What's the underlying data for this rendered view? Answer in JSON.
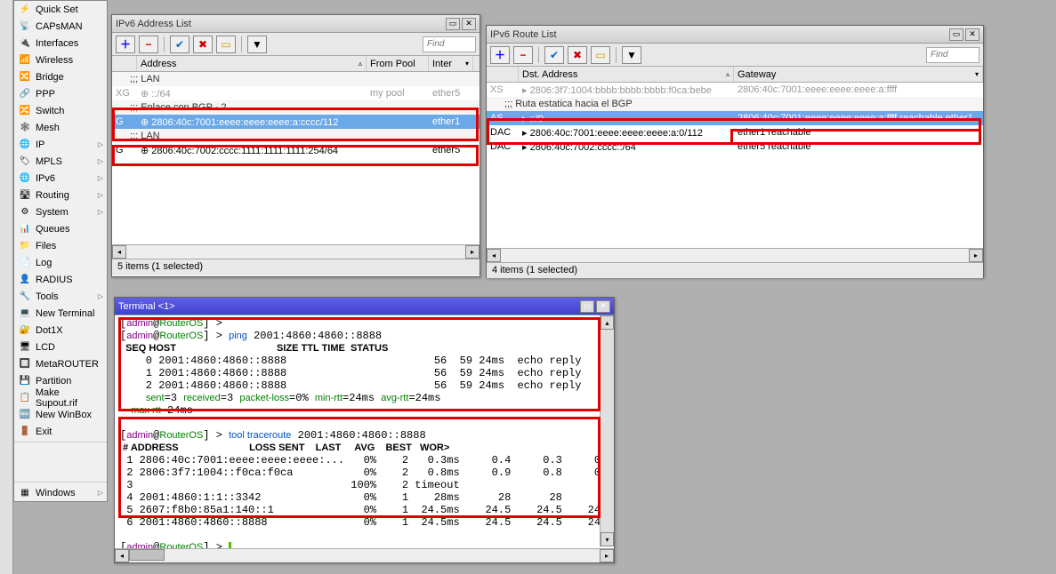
{
  "sidebar": {
    "items": [
      {
        "icon": "⚡",
        "label": "Quick Set"
      },
      {
        "icon": "📡",
        "label": "CAPsMAN"
      },
      {
        "icon": "🔌",
        "label": "Interfaces"
      },
      {
        "icon": "📶",
        "label": "Wireless"
      },
      {
        "icon": "🔀",
        "label": "Bridge"
      },
      {
        "icon": "🔗",
        "label": "PPP"
      },
      {
        "icon": "🔀",
        "label": "Switch"
      },
      {
        "icon": "🕸",
        "label": "Mesh"
      },
      {
        "icon": "🌐",
        "label": "IP",
        "sub": true
      },
      {
        "icon": "🏷",
        "label": "MPLS",
        "sub": true
      },
      {
        "icon": "🌐",
        "label": "IPv6",
        "sub": true
      },
      {
        "icon": "🛣",
        "label": "Routing",
        "sub": true
      },
      {
        "icon": "⚙",
        "label": "System",
        "sub": true
      },
      {
        "icon": "📊",
        "label": "Queues"
      },
      {
        "icon": "📁",
        "label": "Files"
      },
      {
        "icon": "📄",
        "label": "Log"
      },
      {
        "icon": "👤",
        "label": "RADIUS"
      },
      {
        "icon": "🔧",
        "label": "Tools",
        "sub": true
      },
      {
        "icon": "💻",
        "label": "New Terminal"
      },
      {
        "icon": "🔐",
        "label": "Dot1X"
      },
      {
        "icon": "🖥",
        "label": "LCD"
      },
      {
        "icon": "🔲",
        "label": "MetaROUTER"
      },
      {
        "icon": "💾",
        "label": "Partition"
      },
      {
        "icon": "📋",
        "label": "Make Supout.rif"
      },
      {
        "icon": "🆕",
        "label": "New WinBox"
      },
      {
        "icon": "🚪",
        "label": "Exit"
      }
    ],
    "windows_label": "Windows"
  },
  "addr_window": {
    "title": "IPv6 Address List",
    "find": "Find",
    "headers": {
      "address": "Address",
      "from_pool": "From Pool",
      "interface": "Inter"
    },
    "rows": [
      {
        "flag": "",
        "comment": ";;; LAN"
      },
      {
        "flag": "XG",
        "addr": "::/64",
        "pool": "my pool",
        "iface": "ether5",
        "gray": true
      },
      {
        "flag": "",
        "comment": ";;; Enlace con BGP - 2"
      },
      {
        "flag": "G",
        "addr": "2806:40c:7001:eeee:eeee:eeee:a:cccc/112",
        "pool": "",
        "iface": "ether1",
        "selected": true
      },
      {
        "flag": "",
        "comment": ";;; LAN"
      },
      {
        "flag": "G",
        "addr": "2806:40c:7002:cccc:1111:1111:1111:254/64",
        "pool": "",
        "iface": "ether5"
      }
    ],
    "status": "5 items (1 selected)"
  },
  "route_window": {
    "title": "IPv6 Route List",
    "find": "Find",
    "headers": {
      "dst": "Dst. Address",
      "gateway": "Gateway"
    },
    "rows": [
      {
        "flag": "XS",
        "dst": "2806:3f7:1004:bbbb:bbbb:bbbb:f0ca:bebe",
        "gw": "2806:40c:7001:eeee:eeee:eeee:a:ffff",
        "gray": true
      },
      {
        "flag": "",
        "comment": ";;; Ruta estatica hacia el BGP"
      },
      {
        "flag": "AS",
        "dst": "::/0",
        "gw": "2806:40c:7001:eeee:eeee:eeee:a:ffff reachable ether1",
        "selected": true
      },
      {
        "flag": "DAC",
        "dst": "2806:40c:7001:eeee:eeee:eeee:a:0/112",
        "gw": "ether1 reachable"
      },
      {
        "flag": "DAC",
        "dst": "2806:40c:7002:cccc::/64",
        "gw": "ether5 reachable"
      }
    ],
    "status": "4 items (1 selected)"
  },
  "terminal": {
    "title": "Terminal <1>",
    "prompt_user": "admin",
    "prompt_host": "RouterOS",
    "ping_cmd": "ping",
    "ping_target": "2001:4860:4860::8888",
    "ping_header": "  SEQ HOST                                     SIZE TTL TIME  STATUS",
    "ping_rows": [
      "    0 2001:4860:4860::8888                       56  59 24ms  echo reply",
      "    1 2001:4860:4860::8888                       56  59 24ms  echo reply",
      "    2 2001:4860:4860::8888                       56  59 24ms  echo reply"
    ],
    "ping_summary_sent": "sent",
    "ping_summary_recv": "received",
    "ping_summary_pl": "packet-loss",
    "ping_summary_min": "min-rtt",
    "ping_summary_avg": "avg-rtt",
    "ping_summary": "    sent=3 received=3 packet-loss=0% min-rtt=24ms avg-rtt=24ms",
    "ping_maxrtt": "    max-rtt=24ms",
    "tr_cmd": "tool traceroute",
    "tr_target": "2001:4860:4860::8888",
    "tr_header": " # ADDRESS                          LOSS SENT    LAST     AVG    BEST   WOR>",
    "tr_rows": [
      " 1 2806:40c:7001:eeee:eeee:eeee:...   0%    2   0.3ms     0.4     0.3     0>",
      " 2 2806:3f7:1004::f0ca:f0ca           0%    2   0.8ms     0.9     0.8     0>",
      " 3                                  100%    2 timeout",
      " 4 2001:4860:1:1::3342                0%    1    28ms      28      28      >",
      " 5 2607:f8b0:85a1:140::1              0%    1  24.5ms    24.5    24.5    24>",
      " 6 2001:4860:4860::8888               0%    1  24.5ms    24.5    24.5    24>"
    ]
  }
}
